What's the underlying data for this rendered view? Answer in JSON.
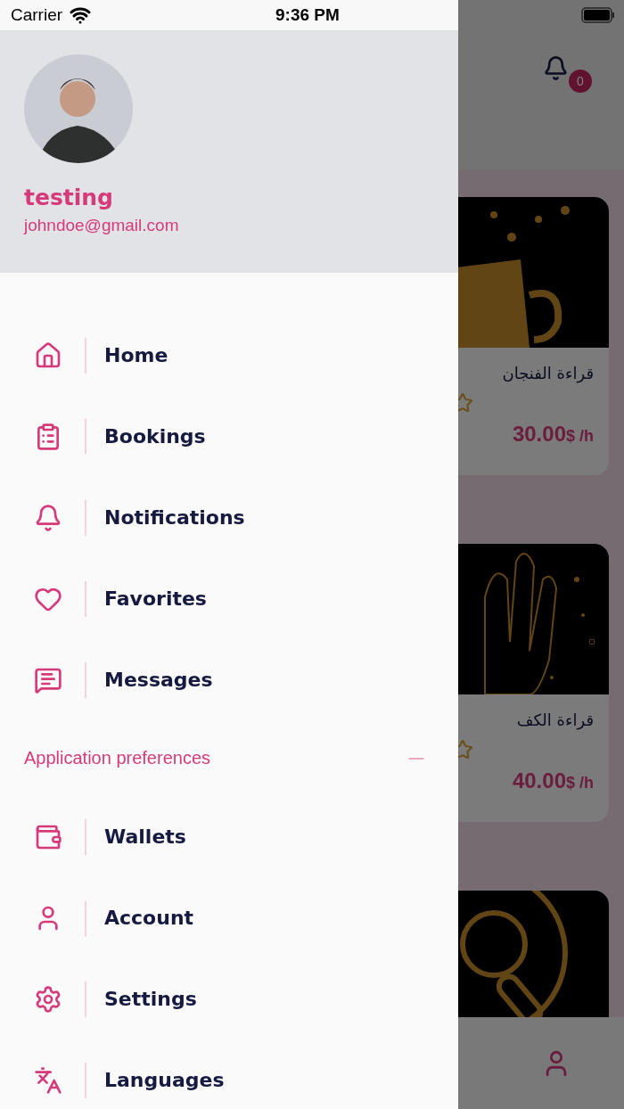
{
  "status_bar": {
    "carrier": "Carrier",
    "time": "9:36 PM"
  },
  "profile": {
    "name": "testing",
    "email": "johndoe@gmail.com"
  },
  "menu": [
    {
      "label": "Home"
    },
    {
      "label": "Bookings"
    },
    {
      "label": "Notifications"
    },
    {
      "label": "Favorites"
    },
    {
      "label": "Messages"
    }
  ],
  "preferences": {
    "title": "Application preferences",
    "expanded": true,
    "items": [
      {
        "label": "Wallets"
      },
      {
        "label": "Account"
      },
      {
        "label": "Settings"
      },
      {
        "label": "Languages"
      }
    ]
  },
  "background": {
    "notification_count": "0",
    "cards": [
      {
        "kind": "product",
        "title": "قراءة الفنجان",
        "price": "30.00",
        "unit": "$ /h"
      },
      {
        "kind": "product",
        "title": "قراءة الكف",
        "price": "40.00",
        "unit": "$ /h"
      },
      {
        "kind": "picture"
      }
    ]
  }
}
